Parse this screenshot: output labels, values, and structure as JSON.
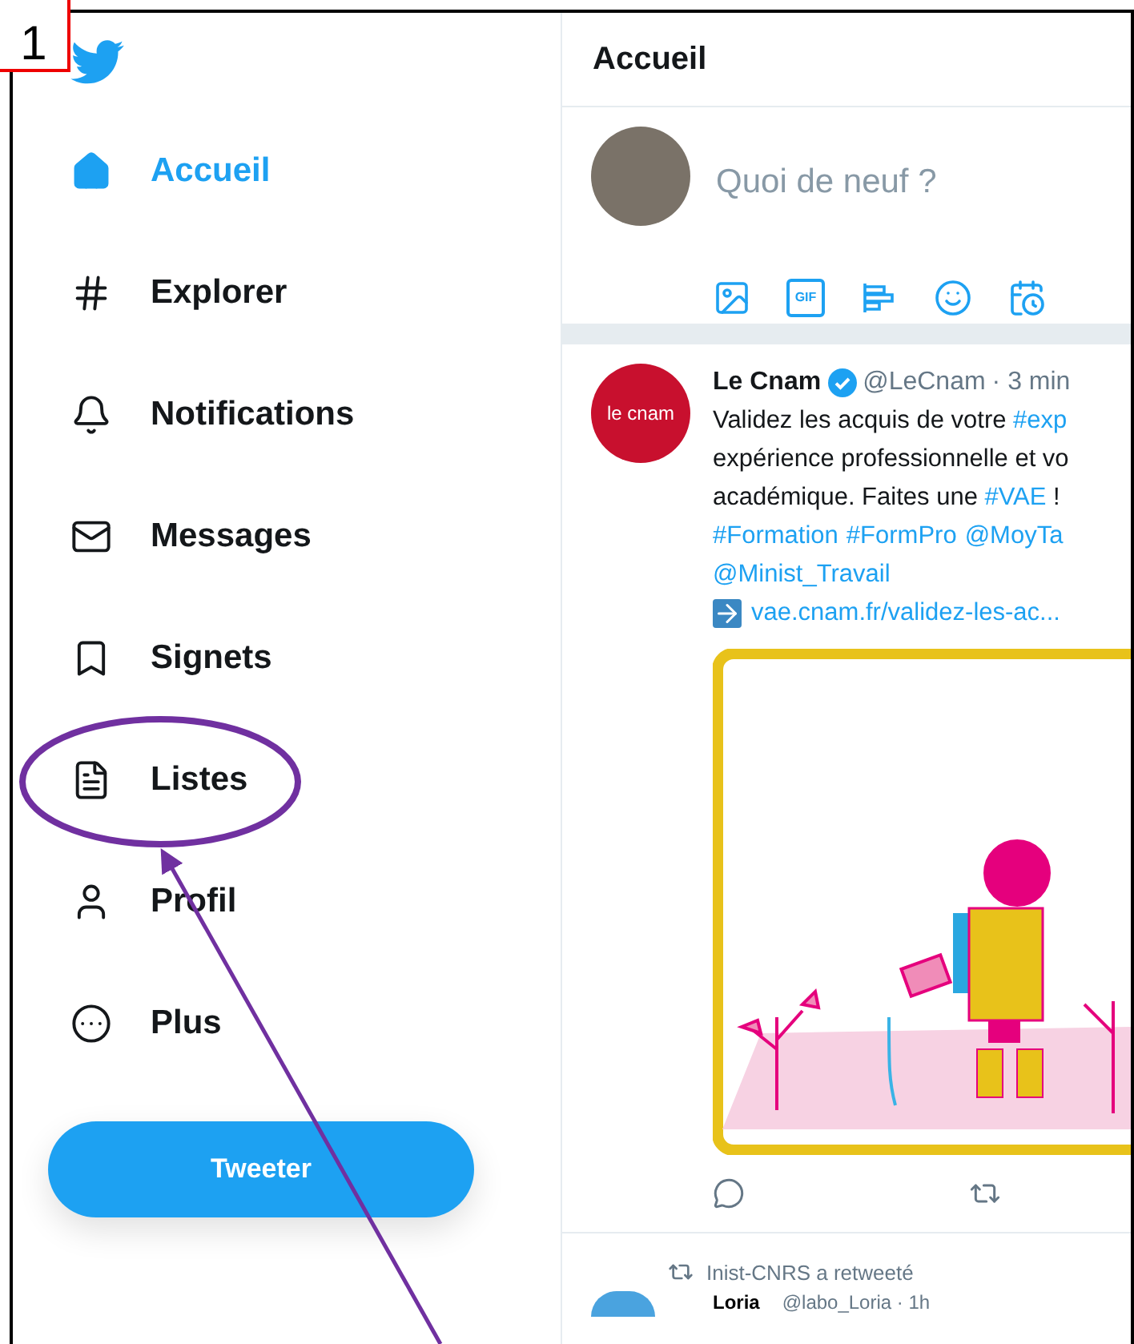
{
  "annotation": {
    "label": "1"
  },
  "sidebar": {
    "items": [
      {
        "label": "Accueil",
        "selected": true
      },
      {
        "label": "Explorer",
        "selected": false
      },
      {
        "label": "Notifications",
        "selected": false
      },
      {
        "label": "Messages",
        "selected": false
      },
      {
        "label": "Signets",
        "selected": false
      },
      {
        "label": "Listes",
        "selected": false
      },
      {
        "label": "Profil",
        "selected": false
      },
      {
        "label": "Plus",
        "selected": false
      }
    ],
    "tweet_button": "Tweeter"
  },
  "main": {
    "title": "Accueil",
    "compose": {
      "placeholder": "Quoi de neuf ?",
      "tools": [
        {
          "kind": "image"
        },
        {
          "kind": "gif",
          "label": "GIF"
        },
        {
          "kind": "poll"
        },
        {
          "kind": "emoji"
        },
        {
          "kind": "schedule"
        }
      ]
    },
    "tweet": {
      "logo_text": "le cnam",
      "name": "Le Cnam",
      "verified": true,
      "handle": "@LeCnam",
      "time": "· 3 min",
      "lines": [
        [
          {
            "kind": "text",
            "text": "Validez les acquis de votre "
          },
          {
            "kind": "link",
            "text": "#exp"
          }
        ],
        [
          {
            "kind": "text",
            "text": "expérience professionnelle et vo"
          }
        ],
        [
          {
            "kind": "text",
            "text": "académique. Faites une "
          },
          {
            "kind": "link",
            "text": "#VAE"
          },
          {
            "kind": "text",
            "text": " !"
          }
        ],
        [
          {
            "kind": "link",
            "text": "#Formation"
          },
          {
            "kind": "link",
            "text": "#FormPro"
          },
          {
            "kind": "link",
            "text": "@MoyTa"
          }
        ],
        [
          {
            "kind": "link",
            "text": "@Minist_Travail"
          }
        ]
      ],
      "url": "vae.cnam.fr/validez-les-ac..."
    },
    "retweet_notice": "Inist-CNRS a retweeté",
    "next_tweet": {
      "name": "Loria",
      "handle": "@labo_Loria · 1h"
    }
  }
}
